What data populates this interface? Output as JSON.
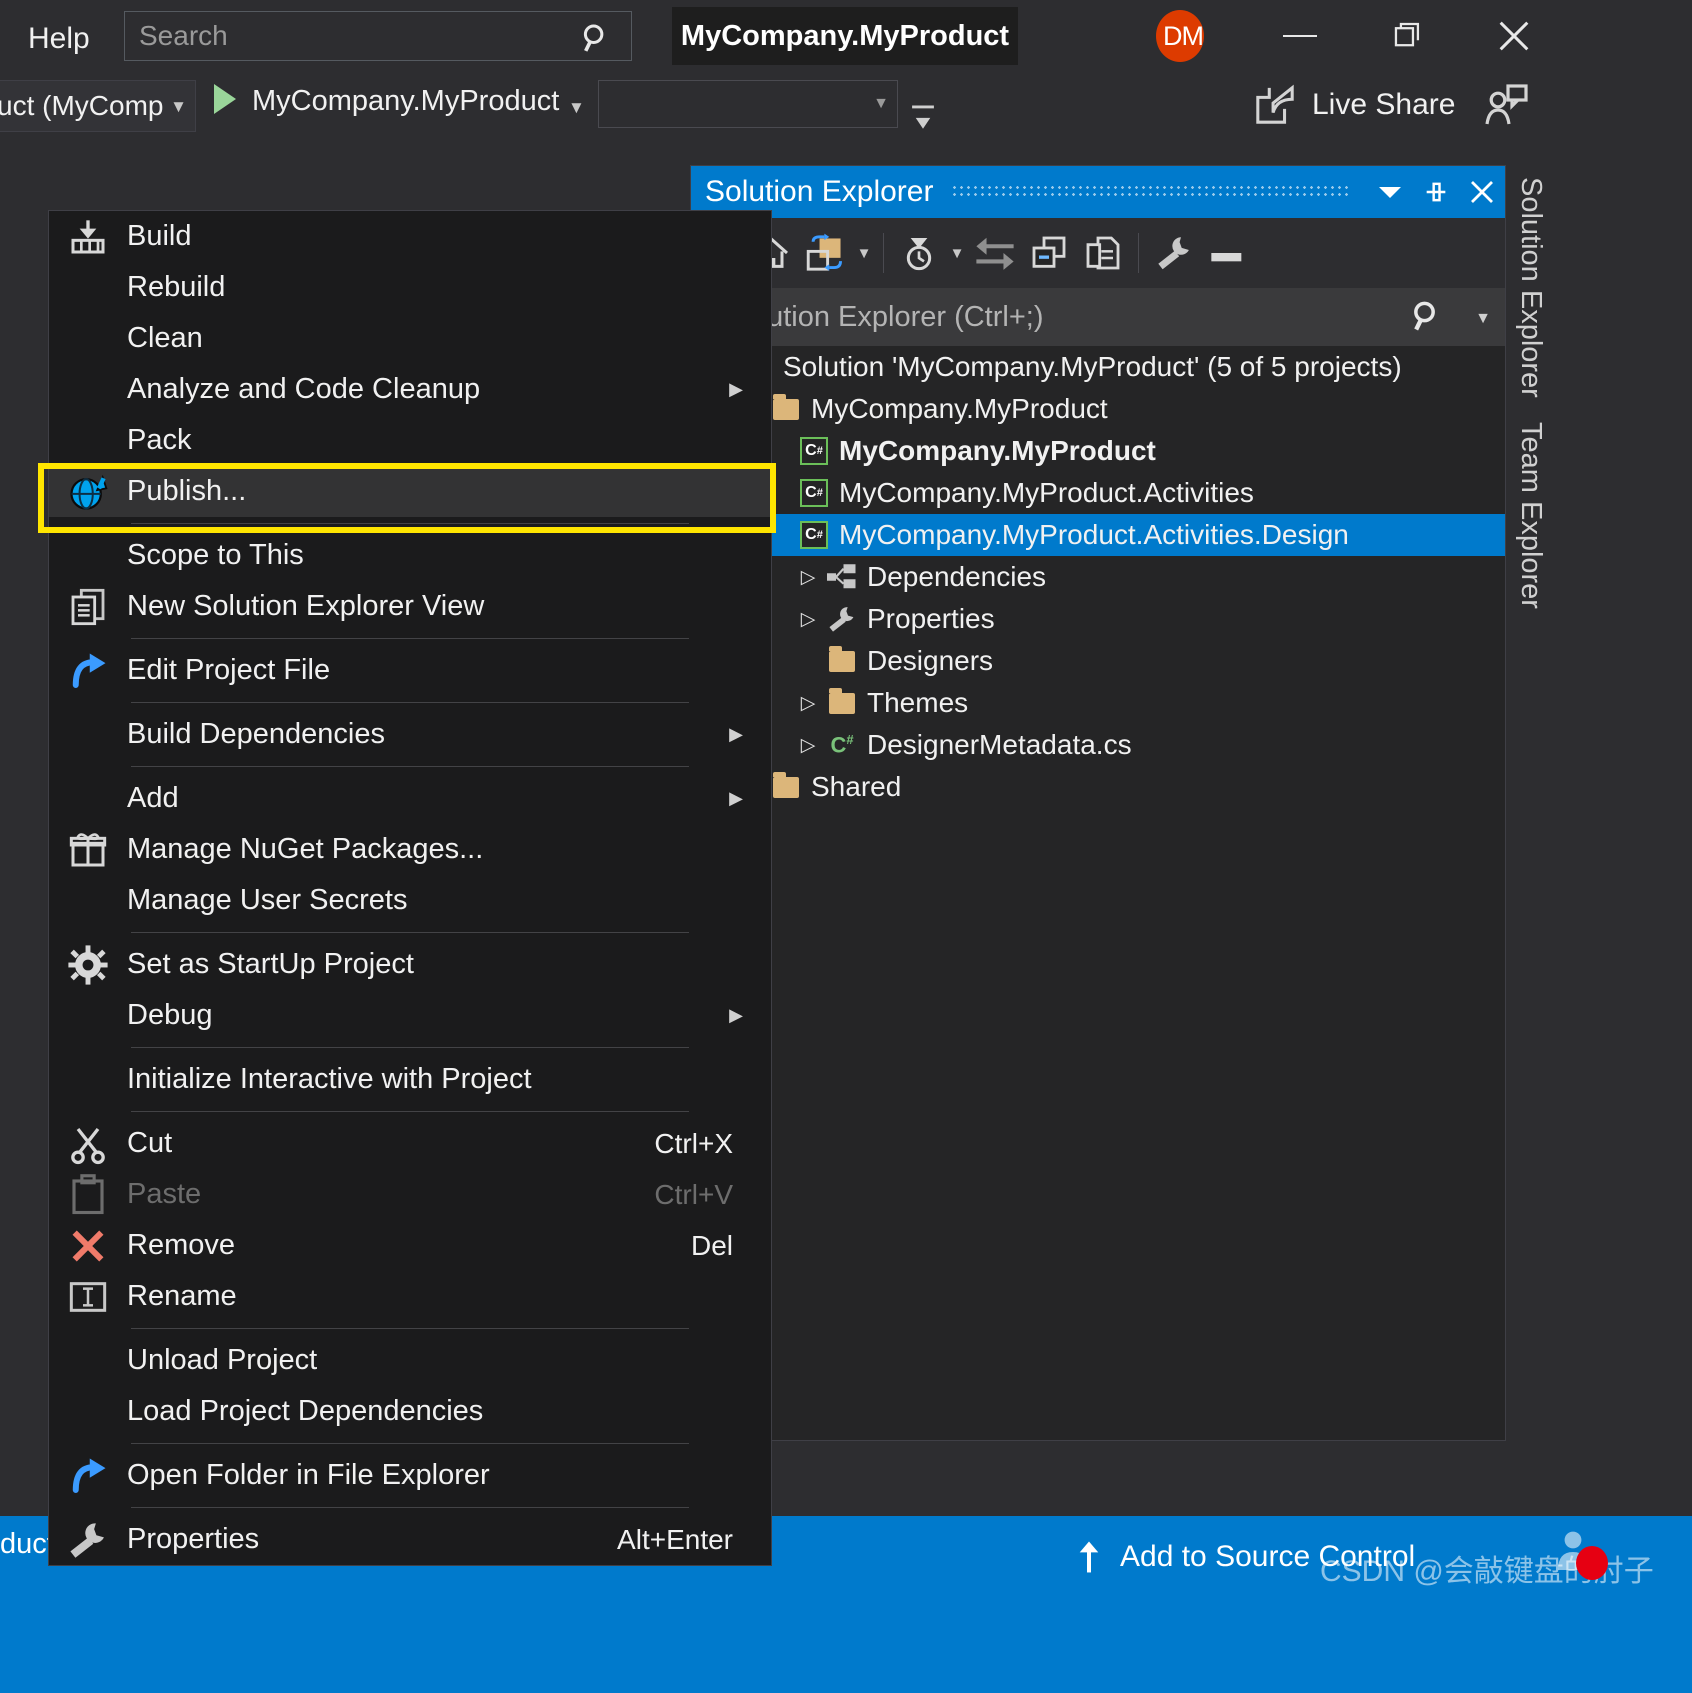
{
  "titlebar": {
    "help_label": "Help",
    "search_placeholder": "Search",
    "search_icon": "search-icon",
    "window_title": "MyCompany.MyProduct",
    "avatar_initials": "DM",
    "minimize_label": "—",
    "restore_icon": "restore-window-icon",
    "close_icon": "close-icon"
  },
  "toolbar": {
    "configuration": "uct (MyComp",
    "run_label": "MyCompany.MyProduct",
    "run_icon": "play-icon",
    "target_placeholder": "",
    "overflow_icon": "toolbar-overflow-icon",
    "live_share_label": "Live Share",
    "live_share_icon": "share-icon",
    "feedback_icon": "send-feedback-icon"
  },
  "context_menu": {
    "items": [
      {
        "label": "Build",
        "icon": "build-icon",
        "shortcut": "",
        "submenu": false,
        "disabled": false,
        "highlighted": false,
        "sep_after": false
      },
      {
        "label": "Rebuild",
        "icon": "",
        "shortcut": "",
        "submenu": false,
        "disabled": false,
        "highlighted": false,
        "sep_after": false
      },
      {
        "label": "Clean",
        "icon": "",
        "shortcut": "",
        "submenu": false,
        "disabled": false,
        "highlighted": false,
        "sep_after": false
      },
      {
        "label": "Analyze and Code Cleanup",
        "icon": "",
        "shortcut": "",
        "submenu": true,
        "disabled": false,
        "highlighted": false,
        "sep_after": false
      },
      {
        "label": "Pack",
        "icon": "",
        "shortcut": "",
        "submenu": false,
        "disabled": false,
        "highlighted": false,
        "sep_after": false
      },
      {
        "label": "Publish...",
        "icon": "publish-globe-icon",
        "shortcut": "",
        "submenu": false,
        "disabled": false,
        "highlighted": true,
        "sep_after": true
      },
      {
        "label": "Scope to This",
        "icon": "",
        "shortcut": "",
        "submenu": false,
        "disabled": false,
        "highlighted": false,
        "sep_after": false
      },
      {
        "label": "New Solution Explorer View",
        "icon": "new-solution-explorer-view-icon",
        "shortcut": "",
        "submenu": false,
        "disabled": false,
        "highlighted": false,
        "sep_after": true
      },
      {
        "label": "Edit Project File",
        "icon": "edit-project-file-icon",
        "shortcut": "",
        "submenu": false,
        "disabled": false,
        "highlighted": false,
        "sep_after": true
      },
      {
        "label": "Build Dependencies",
        "icon": "",
        "shortcut": "",
        "submenu": true,
        "disabled": false,
        "highlighted": false,
        "sep_after": true
      },
      {
        "label": "Add",
        "icon": "",
        "shortcut": "",
        "submenu": true,
        "disabled": false,
        "highlighted": false,
        "sep_after": false
      },
      {
        "label": "Manage NuGet Packages...",
        "icon": "nuget-package-icon",
        "shortcut": "",
        "submenu": false,
        "disabled": false,
        "highlighted": false,
        "sep_after": false
      },
      {
        "label": "Manage User Secrets",
        "icon": "",
        "shortcut": "",
        "submenu": false,
        "disabled": false,
        "highlighted": false,
        "sep_after": true
      },
      {
        "label": "Set as StartUp Project",
        "icon": "gear-icon",
        "shortcut": "",
        "submenu": false,
        "disabled": false,
        "highlighted": false,
        "sep_after": false
      },
      {
        "label": "Debug",
        "icon": "",
        "shortcut": "",
        "submenu": true,
        "disabled": false,
        "highlighted": false,
        "sep_after": true
      },
      {
        "label": "Initialize Interactive with Project",
        "icon": "",
        "shortcut": "",
        "submenu": false,
        "disabled": false,
        "highlighted": false,
        "sep_after": true
      },
      {
        "label": "Cut",
        "icon": "scissors-icon",
        "shortcut": "Ctrl+X",
        "submenu": false,
        "disabled": false,
        "highlighted": false,
        "sep_after": false
      },
      {
        "label": "Paste",
        "icon": "clipboard-icon",
        "shortcut": "Ctrl+V",
        "submenu": false,
        "disabled": true,
        "highlighted": false,
        "sep_after": false
      },
      {
        "label": "Remove",
        "icon": "remove-x-icon",
        "shortcut": "Del",
        "submenu": false,
        "disabled": false,
        "highlighted": false,
        "sep_after": false
      },
      {
        "label": "Rename",
        "icon": "rename-icon",
        "shortcut": "",
        "submenu": false,
        "disabled": false,
        "highlighted": false,
        "sep_after": true
      },
      {
        "label": "Unload Project",
        "icon": "",
        "shortcut": "",
        "submenu": false,
        "disabled": false,
        "highlighted": false,
        "sep_after": false
      },
      {
        "label": "Load Project Dependencies",
        "icon": "",
        "shortcut": "",
        "submenu": false,
        "disabled": false,
        "highlighted": false,
        "sep_after": true
      },
      {
        "label": "Open Folder in File Explorer",
        "icon": "open-folder-icon",
        "shortcut": "",
        "submenu": false,
        "disabled": false,
        "highlighted": false,
        "sep_after": true
      },
      {
        "label": "Properties",
        "icon": "wrench-icon",
        "shortcut": "Alt+Enter",
        "submenu": false,
        "disabled": false,
        "highlighted": false,
        "sep_after": false
      }
    ]
  },
  "solution_explorer": {
    "title": "Solution Explorer",
    "header_buttons": [
      "chevron-down-icon",
      "pin-icon",
      "close-icon"
    ],
    "toolbar_icons": [
      "back-icon",
      "home-icon",
      "sync-with-active-document-icon",
      "chevron-down-icon",
      "pending-changes-filter-icon",
      "chevron-down-icon",
      "sync-icon",
      "collapse-all-icon",
      "show-all-files-icon",
      "properties-wrench-icon",
      "preview-selected-items-icon"
    ],
    "search_placeholder": "h Solution Explorer (Ctrl+;)",
    "search_icon": "search-icon",
    "search_dropdown_icon": "chevron-down-icon",
    "tree": [
      {
        "label": "Solution 'MyCompany.MyProduct' (5 of 5 projects)",
        "icon": "solution-icon",
        "indent": 0,
        "arrow": "",
        "bold": false,
        "selected": false
      },
      {
        "label": "MyCompany.MyProduct",
        "icon": "folder-icon",
        "indent": 1,
        "arrow": "▶",
        "bold": false,
        "selected": false
      },
      {
        "label": "MyCompany.MyProduct",
        "icon": "csharp-project-icon",
        "indent": 2,
        "arrow": "",
        "bold": true,
        "selected": false
      },
      {
        "label": "MyCompany.MyProduct.Activities",
        "icon": "csharp-project-icon",
        "indent": 2,
        "arrow": "",
        "bold": false,
        "selected": false
      },
      {
        "label": "MyCompany.MyProduct.Activities.Design",
        "icon": "csharp-project-icon",
        "indent": 2,
        "arrow": "",
        "bold": false,
        "selected": true
      },
      {
        "label": "Dependencies",
        "icon": "dependencies-icon",
        "indent": 3,
        "arrow": "▷",
        "bold": false,
        "selected": false
      },
      {
        "label": "Properties",
        "icon": "wrench-icon",
        "indent": 3,
        "arrow": "▷",
        "bold": false,
        "selected": false
      },
      {
        "label": "Designers",
        "icon": "folder-icon",
        "indent": 3,
        "arrow": "",
        "bold": false,
        "selected": false
      },
      {
        "label": "Themes",
        "icon": "folder-icon",
        "indent": 3,
        "arrow": "▷",
        "bold": false,
        "selected": false
      },
      {
        "label": "DesignerMetadata.cs",
        "icon": "csharp-file-icon",
        "indent": 3,
        "arrow": "▷",
        "bold": false,
        "selected": false
      },
      {
        "label": "Shared",
        "icon": "folder-icon",
        "indent": 1,
        "arrow": "",
        "bold": false,
        "selected": false
      }
    ],
    "vertical_tabs": [
      "Solution Explorer",
      "Team Explorer"
    ]
  },
  "statusbar": {
    "left_text": "duct'",
    "source_control_label": "Add to Source Control",
    "source_control_icon": "up-arrow-icon",
    "watermark": "CSDN @会敲键盘的肘子"
  },
  "colors": {
    "accent": "#007acc",
    "highlight": "#ffe500",
    "avatar": "#dd3b00",
    "folder": "#dcb67a",
    "csharp_green": "#6bbf59",
    "menu_bg": "#1b1b1c",
    "panel_bg": "#252526",
    "chrome_bg": "#2d2d30"
  }
}
